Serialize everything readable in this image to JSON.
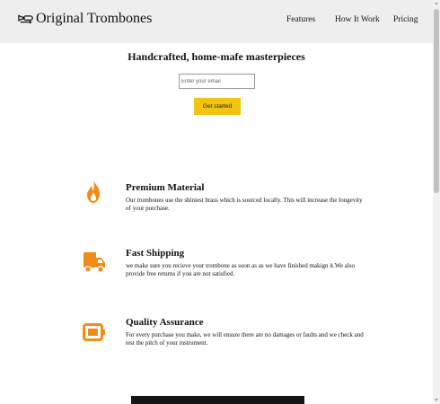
{
  "header": {
    "brand": "Original Trombones",
    "nav": [
      "Features",
      "How It Work",
      "Pricing"
    ]
  },
  "hero": {
    "title": "Handcrafted, home-mafe masterpieces",
    "email_placeholder": "Enter your email",
    "cta_label": "Get started"
  },
  "features": [
    {
      "icon": "fire-icon",
      "title": "Premium Material",
      "text": "Our trombones use the shiniest brass which is sourced locally. This will increase the longevity of your purchase."
    },
    {
      "icon": "truck-icon",
      "title": "Fast Shipping",
      "text": "we make sure you recieve your trombone as soon as as we have finished makign it.We also provide free returns if you are not satisfied."
    },
    {
      "icon": "battery-icon",
      "title": "Quality Assurance",
      "text": "For every purchase you make, we will ensure there are no damages or faults and we check and test the pitch of your instrument."
    }
  ],
  "colors": {
    "accent": "#f1c40f",
    "icon_orange": "#f28c18",
    "header_bg": "#eeeeee"
  }
}
